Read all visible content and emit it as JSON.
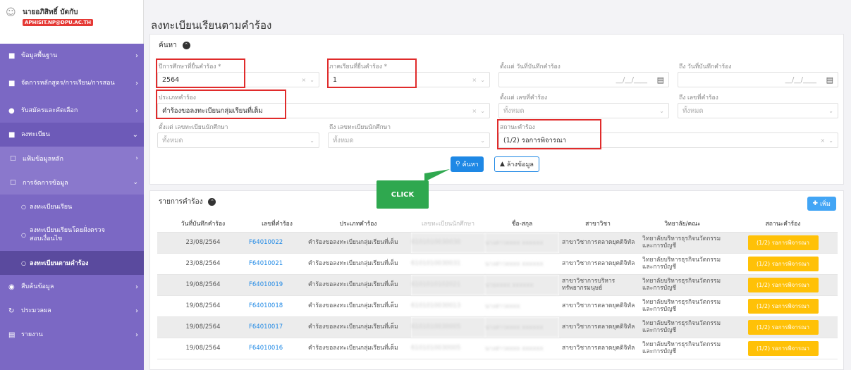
{
  "user": {
    "name": "นายอภิสิทธิ์ บัดกับ",
    "email": "APHISIT.NP@DPU.AC.TH"
  },
  "sidebar": {
    "items": [
      {
        "label": "ข้อมูลพื้นฐาน"
      },
      {
        "label": "จัดการหลักสูตร/การเรียน/การสอน"
      },
      {
        "label": "รับสมัครและคัดเลือก"
      },
      {
        "label": "ลงทะเบียน"
      }
    ],
    "sub_items": [
      {
        "label": "แฟ้มข้อมูลหลัก"
      },
      {
        "label": "การจัดการข้อมูล"
      }
    ],
    "subsub_items": [
      {
        "label": "ลงทะเบียนเรียน"
      },
      {
        "label": "ลงทะเบียนเรียนโดยฝั่งตรวจสอบเงื่อนไข"
      },
      {
        "label": "ลงทะเบียนตามคำร้อง"
      }
    ],
    "bottom_items": [
      {
        "label": "สืบค้นข้อมูล"
      },
      {
        "label": "ประมวลผล"
      },
      {
        "label": "รายงาน"
      }
    ]
  },
  "page": {
    "title": "ลงทะเบียนเรียนตามคำร้อง"
  },
  "search": {
    "heading": "ค้นหา",
    "year_label": "ปีการศึกษาที่ยื่นคำร้อง *",
    "year_value": "2564",
    "semester_label": "ภาคเรียนที่ยื่นคำร้อง *",
    "semester_value": "1",
    "date_from_label": "ตั้งแต่ วันที่บันทึกคำร้อง",
    "date_from_value": "__/__/____",
    "date_to_label": "ถึง วันที่บันทึกคำร้อง",
    "date_to_value": "__/__/____",
    "type_label": "ประเภทคำร้อง",
    "type_value": "คำร้องขอลงทะเบียนกลุ่มเรียนที่เต็ม",
    "req_from_label": "ตั้งแต่ เลขที่คำร้อง",
    "req_from_placeholder": "ทั้งหมด",
    "req_to_label": "ถึง เลขที่คำร้อง",
    "req_to_placeholder": "ทั้งหมด",
    "sid_from_label": "ตั้งแต่ เลขทะเบียนนักศึกษา",
    "sid_from_placeholder": "ทั้งหมด",
    "sid_to_label": "ถึง เลขทะเบียนนักศึกษา",
    "sid_to_placeholder": "ทั้งหมด",
    "status_label": "สถานะคำร้อง",
    "status_value": "(1/2) รอการพิจารณา",
    "search_button": "ค้นหา",
    "clear_button": "ล้างข้อมูล",
    "clear_x": "×"
  },
  "annotation": {
    "label": "CLICK"
  },
  "list": {
    "heading": "รายการคำร้อง",
    "add_button": "เพิ่ม",
    "columns": [
      "วันที่บันทึกคำร้อง",
      "เลขที่คำร้อง",
      "ประเภทคำร้อง",
      "เลขทะเบียนนักศึกษา",
      "ชื่อ-สกุล",
      "สาขาวิชา",
      "วิทยาลัย/คณะ",
      "สถานะคำร้อง"
    ],
    "rows": [
      {
        "date": "23/08/2564",
        "no": "F64010022",
        "type": "คำร้องขอลงทะเบียนกลุ่มเรียนที่เต็ม",
        "sid": "6101010030030",
        "name": "นางสาวxxxx xxxxxx",
        "major": "สาขาวิชาการตลาดยุคดิจิทัล",
        "faculty": "วิทยาลัยบริหารธุรกิจนวัตกรรมและการบัญชี",
        "status": "(1/2) รอการพิจารณา"
      },
      {
        "date": "23/08/2564",
        "no": "F64010021",
        "type": "คำร้องขอลงทะเบียนกลุ่มเรียนที่เต็ม",
        "sid": "6101010030031",
        "name": "นางสาวxxxx xxxxxx",
        "major": "สาขาวิชาการตลาดยุคดิจิทัล",
        "faculty": "วิทยาลัยบริหารธุรกิจนวัตกรรมและการบัญชี",
        "status": "(1/2) รอการพิจารณา"
      },
      {
        "date": "19/08/2564",
        "no": "F64010019",
        "type": "คำร้องขอลงทะเบียนกลุ่มเรียนที่เต็ม",
        "sid": "6101010102021",
        "name": "นายxxxx xxxxxx",
        "major": "สาขาวิชาการบริหารทรัพยากรมนุษย์",
        "faculty": "วิทยาลัยบริหารธุรกิจนวัตกรรมและการบัญชี",
        "status": "(1/2) รอการพิจารณา"
      },
      {
        "date": "19/08/2564",
        "no": "F64010018",
        "type": "คำร้องขอลงทะเบียนกลุ่มเรียนที่เต็ม",
        "sid": "6101010030013",
        "name": "นางสาวxxxx",
        "major": "สาขาวิชาการตลาดยุคดิจิทัล",
        "faculty": "วิทยาลัยบริหารธุรกิจนวัตกรรมและการบัญชี",
        "status": "(1/2) รอการพิจารณา"
      },
      {
        "date": "19/08/2564",
        "no": "F64010017",
        "type": "คำร้องขอลงทะเบียนกลุ่มเรียนที่เต็ม",
        "sid": "6101010030005",
        "name": "นางสาวxxxx xxxxxx",
        "major": "สาขาวิชาการตลาดยุคดิจิทัล",
        "faculty": "วิทยาลัยบริหารธุรกิจนวัตกรรมและการบัญชี",
        "status": "(1/2) รอการพิจารณา"
      },
      {
        "date": "19/08/2564",
        "no": "F64010016",
        "type": "คำร้องขอลงทะเบียนกลุ่มเรียนที่เต็ม",
        "sid": "6101010030005",
        "name": "นางสาวxxxx xxxxxx",
        "major": "สาขาวิชาการตลาดยุคดิจิทัล",
        "faculty": "วิทยาลัยบริหารธุรกิจนวัตกรรมและการบัญชี",
        "status": "(1/2) รอการพิจารณา"
      }
    ]
  }
}
